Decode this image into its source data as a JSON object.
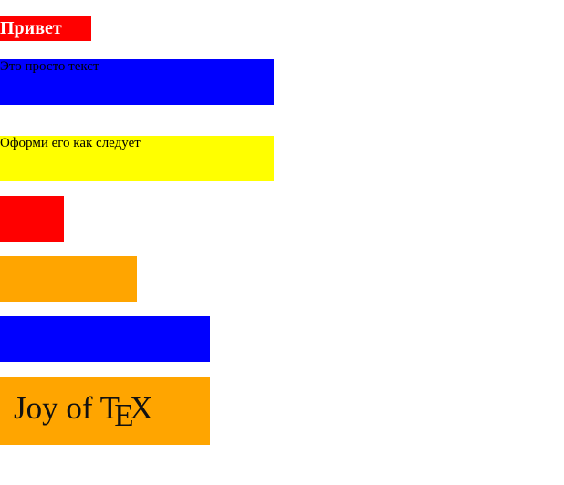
{
  "heading": {
    "text": "Привет"
  },
  "paragraphs": [
    {
      "text": "Это просто текст",
      "background": "#0000ff"
    },
    {
      "text": "Оформи его как следует",
      "background": "#ffff00"
    }
  ],
  "bars": [
    {
      "color": "#ff0000"
    },
    {
      "color": "#ffa500"
    },
    {
      "color": "#0000ff"
    }
  ],
  "logo_box": {
    "background": "#ffa500",
    "prefix": "Joy of",
    "tex_t": "T",
    "tex_e": "E",
    "tex_x": "X"
  }
}
